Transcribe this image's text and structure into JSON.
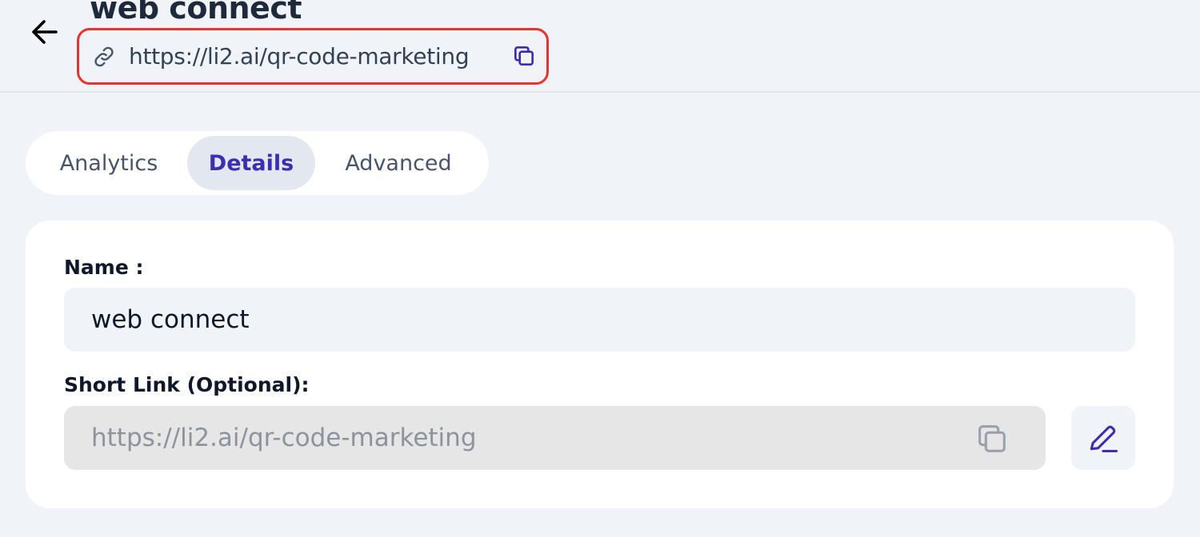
{
  "header": {
    "title": "web connect",
    "link_url": "https://li2.ai/qr-code-marketing",
    "back_icon": "arrow-left-icon",
    "link_icon": "link-icon",
    "copy_icon": "copy-icon"
  },
  "tabs": [
    {
      "label": "Analytics",
      "active": false
    },
    {
      "label": "Details",
      "active": true
    },
    {
      "label": "Advanced",
      "active": false
    }
  ],
  "form": {
    "name_label": "Name :",
    "name_value": "web connect",
    "short_link_label": "Short Link (Optional):",
    "short_link_value": "https://li2.ai/qr-code-marketing",
    "edit_icon": "pencil-icon"
  },
  "colors": {
    "accent": "#3d2db3",
    "highlight_border": "#e8322a",
    "background": "#f0f3f8"
  }
}
